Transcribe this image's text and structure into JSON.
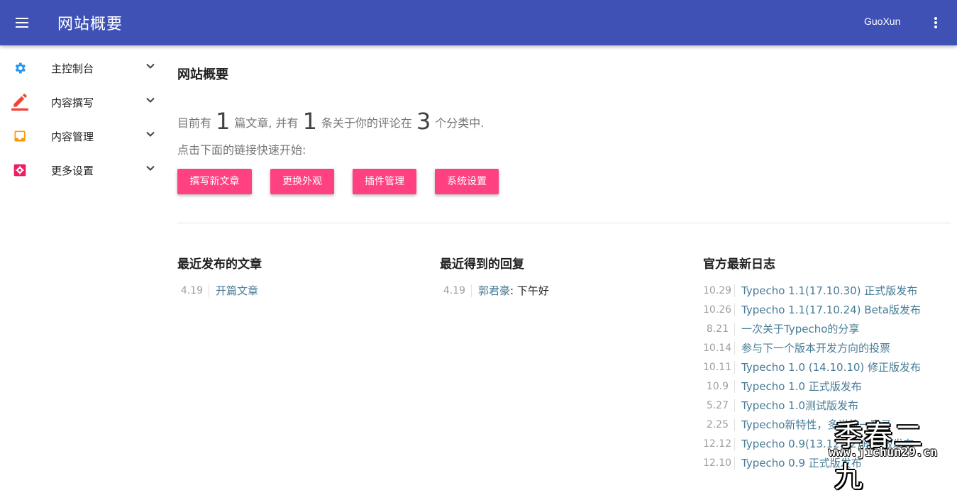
{
  "header": {
    "title": "网站概要",
    "user": "GuoXun"
  },
  "sidebar": {
    "items": [
      {
        "label": "主控制台",
        "icon": "gear-icon",
        "color": "#2196f3"
      },
      {
        "label": "内容撰写",
        "icon": "pencil-icon",
        "color": "#f44336"
      },
      {
        "label": "内容管理",
        "icon": "inbox-icon",
        "color": "#ff9800"
      },
      {
        "label": "更多设置",
        "icon": "settings-box-icon",
        "color": "#e91e63"
      }
    ]
  },
  "main": {
    "title": "网站概要",
    "stats": {
      "p1": "目前有",
      "posts": "1",
      "p2": "篇文章, 并有",
      "comments": "1",
      "p3": "条关于你的评论在",
      "categories": "3",
      "p4": "个分类中."
    },
    "hint": "点击下面的链接快速开始:",
    "buttons": [
      {
        "label": "撰写新文章"
      },
      {
        "label": "更换外观"
      },
      {
        "label": "插件管理"
      },
      {
        "label": "系统设置"
      }
    ],
    "button_color": "#ff4081",
    "recent_posts": {
      "title": "最近发布的文章",
      "items": [
        {
          "date": "4.19",
          "title": "开篇文章"
        }
      ]
    },
    "recent_comments": {
      "title": "最近得到的回复",
      "items": [
        {
          "date": "4.19",
          "author": "郭君豪",
          "text": ": 下午好"
        }
      ]
    },
    "official_log": {
      "title": "官方最新日志",
      "items": [
        {
          "date": "10.29",
          "title": "Typecho 1.1(17.10.30) 正式版发布"
        },
        {
          "date": "10.26",
          "title": "Typecho 1.1(17.10.24) Beta版发布"
        },
        {
          "date": "8.21",
          "title": "一次关于Typecho的分享"
        },
        {
          "date": "10.14",
          "title": "参与下一个版本开发方向的投票"
        },
        {
          "date": "10.11",
          "title": "Typecho 1.0 (14.10.10) 修正版发布"
        },
        {
          "date": "10.9",
          "title": "Typecho 1.0 正式版发布"
        },
        {
          "date": "5.27",
          "title": "Typecho 1.0测试版发布"
        },
        {
          "date": "2.25",
          "title": "Typecho新特性，多说统一登录"
        },
        {
          "date": "12.12",
          "title": "Typecho 0.9(13.12.12)修正版发布"
        },
        {
          "date": "12.10",
          "title": "Typecho 0.9 正式版发布"
        }
      ]
    }
  },
  "watermark": {
    "text": "季春二九",
    "url": "www.jichun29.cn"
  }
}
